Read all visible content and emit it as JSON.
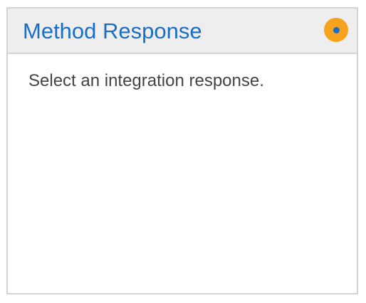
{
  "panel": {
    "title": "Method Response",
    "status_icon": "orange-dot-icon",
    "message": "Select an integration response."
  },
  "colors": {
    "title": "#1a6fc4",
    "header_background": "#eeeeee",
    "border": "#d4d4d4",
    "status_outer": "#f7a21c",
    "status_inner": "#1a6fc4",
    "message_text": "#444444"
  }
}
